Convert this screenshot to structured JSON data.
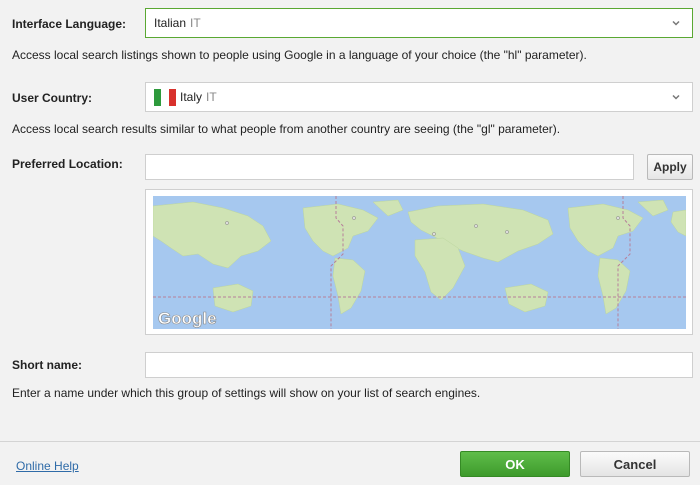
{
  "interface_language": {
    "label": "Interface Language:",
    "value": "Italian",
    "code": "IT",
    "help": "Access local search listings shown to people using Google in a language of your choice (the \"hl\" parameter)."
  },
  "user_country": {
    "label": "User Country:",
    "value": "Italy",
    "code": "IT",
    "flag_colors": [
      "#2e9a3c",
      "#ffffff",
      "#d8312c"
    ],
    "help": "Access local search results similar to what people from another country are seeing (the \"gl\" parameter)."
  },
  "preferred_location": {
    "label": "Preferred Location:",
    "value": "",
    "apply_label": "Apply"
  },
  "map": {
    "logo": "Google",
    "ocean_color": "#a6c8ef",
    "land_color": "#cfe3b4"
  },
  "short_name": {
    "label": "Short name:",
    "value": "",
    "help": "Enter a name under which this group of settings will show on your list of search engines."
  },
  "footer": {
    "help_link": "Online Help",
    "ok_label": "OK",
    "cancel_label": "Cancel"
  },
  "colors": {
    "accent_green": "#4caf38",
    "link_blue": "#2f6ba8"
  }
}
